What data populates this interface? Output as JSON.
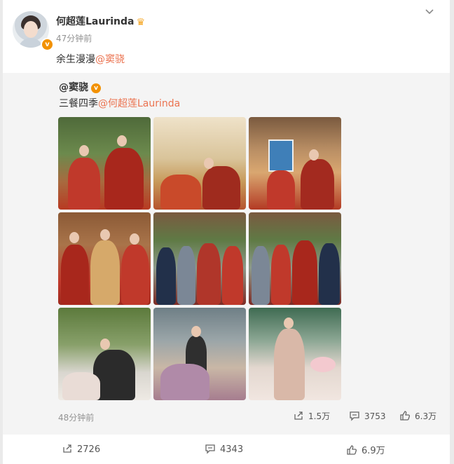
{
  "post": {
    "author": "何超莲Laurinda",
    "time": "47分钟前",
    "text_prefix": "余生漫漫",
    "mention": "@窦骁"
  },
  "repost": {
    "author": "@窦骁",
    "text_prefix": "三餐四季",
    "mention": "@何超莲Laurinda",
    "time": "48分钟前",
    "forwards": "1.5万",
    "comments": "3753",
    "likes": "6.3万"
  },
  "bottom_bar": {
    "forwards": "2726",
    "comments": "4343",
    "likes": "6.9万"
  },
  "icons": {
    "more": "chevron-down-icon",
    "verified": "verified-v-icon",
    "vip": "crown-icon",
    "forward": "share-icon",
    "comment": "comment-icon",
    "like": "thumbs-up-icon"
  },
  "colors": {
    "mention": "#eb7350",
    "verified": "#f29100",
    "meta": "#939393",
    "repost_bg": "#f4f4f4"
  }
}
